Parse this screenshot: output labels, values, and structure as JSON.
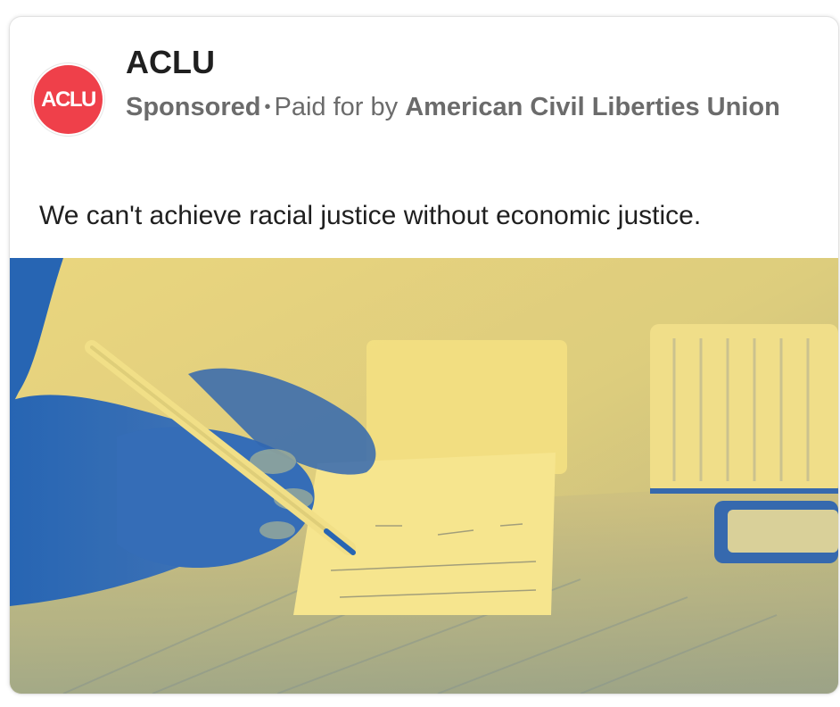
{
  "ad": {
    "advertiser": "ACLU",
    "logo_text": "ACLU",
    "sponsored_label": "Sponsored",
    "separator": "•",
    "paid_for_prefix": "Paid for by",
    "payer": "American Civil Liberties Union",
    "body_text": "We can't achieve racial justice without economic justice."
  },
  "colors": {
    "brand_red": "#ef404a",
    "duotone_yellow": "#f4df7c",
    "duotone_blue": "#1f5fb0"
  },
  "media": {
    "description_icon": "photo-hand-writing-check"
  }
}
